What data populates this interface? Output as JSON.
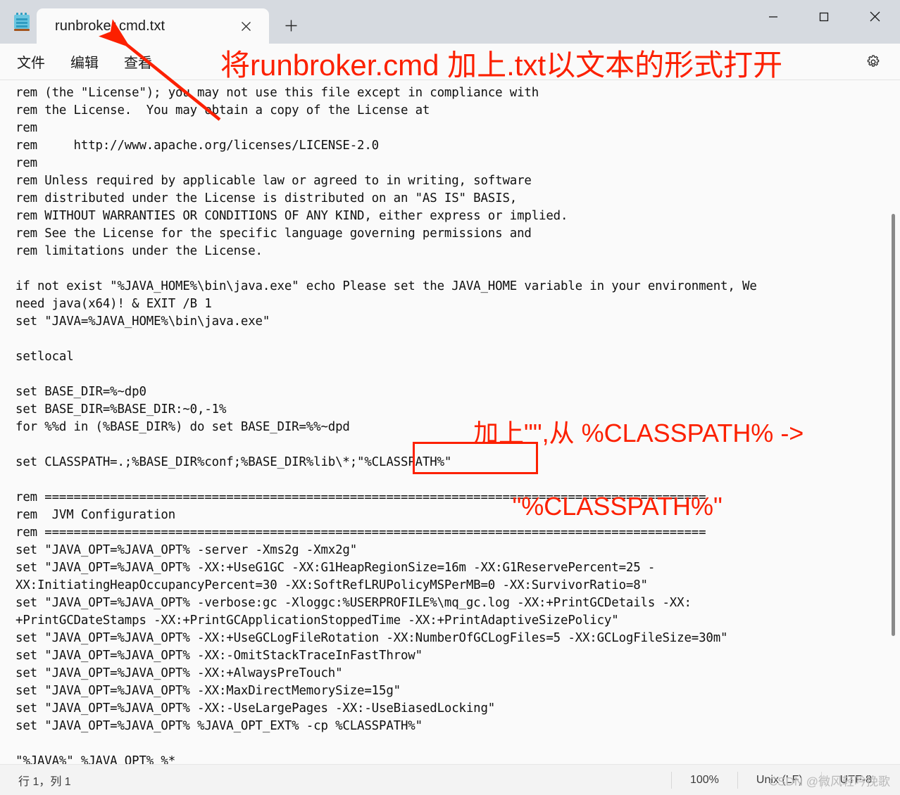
{
  "window": {
    "app_icon": "notepad-icon",
    "controls": {
      "minimize": "—",
      "maximize": "□",
      "close": "✕"
    }
  },
  "tabs": {
    "items": [
      {
        "label": "runbroker.cmd.txt",
        "close": "✕"
      }
    ],
    "new_tab": "+"
  },
  "menubar": {
    "items": [
      {
        "label": "文件"
      },
      {
        "label": "编辑"
      },
      {
        "label": "查看"
      }
    ],
    "settings_icon": "gear-icon"
  },
  "editor": {
    "content": "rem (the \"License\"); you may not use this file except in compliance with\nrem the License.  You may obtain a copy of the License at\nrem\nrem     http://www.apache.org/licenses/LICENSE-2.0\nrem\nrem Unless required by applicable law or agreed to in writing, software\nrem distributed under the License is distributed on an \"AS IS\" BASIS,\nrem WITHOUT WARRANTIES OR CONDITIONS OF ANY KIND, either express or implied.\nrem See the License for the specific language governing permissions and\nrem limitations under the License.\n\nif not exist \"%JAVA_HOME%\\bin\\java.exe\" echo Please set the JAVA_HOME variable in your environment, We\nneed java(x64)! & EXIT /B 1\nset \"JAVA=%JAVA_HOME%\\bin\\java.exe\"\n\nsetlocal\n\nset BASE_DIR=%~dp0\nset BASE_DIR=%BASE_DIR:~0,-1%\nfor %%d in (%BASE_DIR%) do set BASE_DIR=%%~dpd\n\nset CLASSPATH=.;%BASE_DIR%conf;%BASE_DIR%lib\\*;\"%CLASSPATH%\"\n\nrem ===========================================================================================\nrem  JVM Configuration\nrem ===========================================================================================\nset \"JAVA_OPT=%JAVA_OPT% -server -Xms2g -Xmx2g\"\nset \"JAVA_OPT=%JAVA_OPT% -XX:+UseG1GC -XX:G1HeapRegionSize=16m -XX:G1ReservePercent=25 -\nXX:InitiatingHeapOccupancyPercent=30 -XX:SoftRefLRUPolicyMSPerMB=0 -XX:SurvivorRatio=8\"\nset \"JAVA_OPT=%JAVA_OPT% -verbose:gc -Xloggc:%USERPROFILE%\\mq_gc.log -XX:+PrintGCDetails -XX:\n+PrintGCDateStamps -XX:+PrintGCApplicationStoppedTime -XX:+PrintAdaptiveSizePolicy\"\nset \"JAVA_OPT=%JAVA_OPT% -XX:+UseGCLogFileRotation -XX:NumberOfGCLogFiles=5 -XX:GCLogFileSize=30m\"\nset \"JAVA_OPT=%JAVA_OPT% -XX:-OmitStackTraceInFastThrow\"\nset \"JAVA_OPT=%JAVA_OPT% -XX:+AlwaysPreTouch\"\nset \"JAVA_OPT=%JAVA_OPT% -XX:MaxDirectMemorySize=15g\"\nset \"JAVA_OPT=%JAVA_OPT% -XX:-UseLargePages -XX:-UseBiasedLocking\"\nset \"JAVA_OPT=%JAVA_OPT% %JAVA_OPT_EXT% -cp %CLASSPATH%\"\n\n\"%JAVA%\" %JAVA_OPT% %*"
  },
  "statusbar": {
    "position": "行 1，列 1",
    "zoom": "100%",
    "line_ending": "Unix (LF)",
    "encoding": "UTF-8",
    "watermark": "CSDN @微风轻吟挽歌"
  },
  "annotations": {
    "top": "将runbroker.cmd 加上.txt以文本的形式打开",
    "mid_line1": "加上\"\",从 %CLASSPATH% ->",
    "mid_line2": "\"%CLASSPATH%\"",
    "accent_color": "#fc2000"
  }
}
